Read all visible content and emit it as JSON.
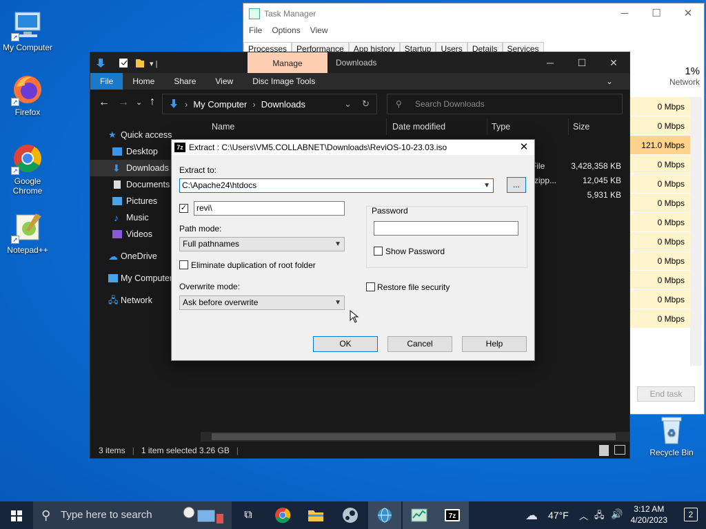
{
  "desktop": {
    "icons": [
      {
        "label": "My Computer"
      },
      {
        "label": "Firefox"
      },
      {
        "label": "Google Chrome"
      },
      {
        "label": "Notepad++"
      },
      {
        "label": "Recycle Bin"
      }
    ]
  },
  "task_manager": {
    "title": "Task Manager",
    "menu": [
      "File",
      "Options",
      "View"
    ],
    "tabs": [
      "Processes",
      "Performance",
      "App history",
      "Startup",
      "Users",
      "Details",
      "Services"
    ],
    "network_header": {
      "percent": "1%",
      "label": "Network"
    },
    "network_rows": [
      "0 Mbps",
      "0 Mbps",
      "121.0 Mbps",
      "0 Mbps",
      "0 Mbps",
      "0 Mbps",
      "0 Mbps",
      "0 Mbps",
      "0 Mbps",
      "0 Mbps",
      "0 Mbps",
      "0 Mbps"
    ],
    "end_task": "End task"
  },
  "explorer": {
    "manage_tab": "Manage",
    "title": "Downloads",
    "ribbon_tabs": [
      "File",
      "Home",
      "Share",
      "View",
      "Disc Image Tools"
    ],
    "address": [
      "My Computer",
      "Downloads"
    ],
    "search_placeholder": "Search Downloads",
    "sidebar": [
      "Quick access",
      "Desktop",
      "Downloads",
      "Documents",
      "Pictures",
      "Music",
      "Videos",
      "OneDrive",
      "My Computer",
      "Network"
    ],
    "columns": [
      "Name",
      "Date modified",
      "Type",
      "Size"
    ],
    "rows": [
      {
        "type": "File",
        "size": "3,428,358 KB"
      },
      {
        "type": "(zipp...",
        "size": "12,045 KB"
      },
      {
        "type": "",
        "size": "5,931 KB"
      }
    ],
    "status": {
      "items": "3 items",
      "selected": "1 item selected  3.26 GB"
    }
  },
  "extract_dialog": {
    "title": "Extract : C:\\Users\\VM5.COLLABNET\\Downloads\\ReviOS-10-23.03.iso",
    "extract_to_label": "Extract to:",
    "extract_to_value": "C:\\Apache24\\htdocs",
    "browse_label": "...",
    "subfolder_value": "revi\\",
    "path_mode_label": "Path mode:",
    "path_mode_value": "Full pathnames",
    "eliminate_dup_label": "Eliminate duplication of root folder",
    "overwrite_mode_label": "Overwrite mode:",
    "overwrite_mode_value": "Ask before overwrite",
    "password_label": "Password",
    "show_password_label": "Show Password",
    "restore_security_label": "Restore file security",
    "ok": "OK",
    "cancel": "Cancel",
    "help": "Help"
  },
  "taskbar": {
    "search_placeholder": "Type here to search",
    "weather": "47°F",
    "time": "3:12 AM",
    "date": "4/20/2023",
    "notifications": "2"
  }
}
